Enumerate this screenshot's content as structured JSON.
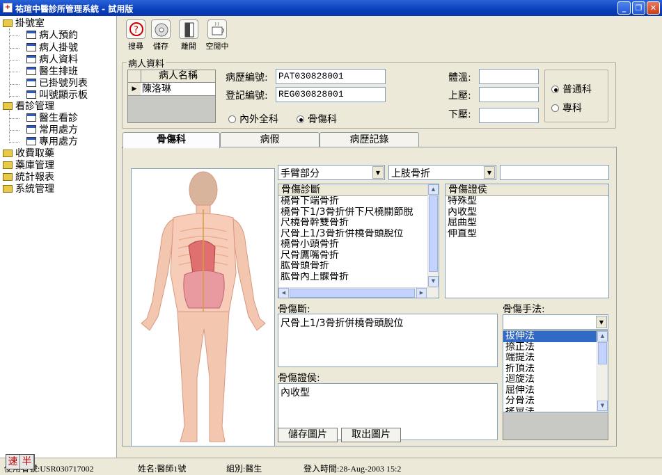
{
  "window": {
    "title": "祐瑄中醫診所管理系統 - 試用版",
    "app_icon_glyph": "+",
    "min": "_",
    "restore": "❐",
    "close": "✕"
  },
  "tree": {
    "groups": [
      {
        "label": "掛號室",
        "children": [
          "病人預約",
          "病人掛號",
          "病人資料",
          "醫生排班",
          "已掛號列表",
          "叫號顯示板"
        ]
      },
      {
        "label": "看診管理",
        "children": [
          "醫生看診",
          "常用處方",
          "專用處方"
        ]
      },
      {
        "label": "收費取藥",
        "children": []
      },
      {
        "label": "藥庫管理",
        "children": []
      },
      {
        "label": "統計報表",
        "children": []
      },
      {
        "label": "系統管理",
        "children": []
      }
    ]
  },
  "toolbar": {
    "search": "搜尋",
    "save": "儲存",
    "leave": "離開",
    "idle": "空閒中"
  },
  "patient": {
    "group_label": "病人資料",
    "grid_header": "病人名稱",
    "grid_row_marker": "▶",
    "grid_row": "陳洛琳",
    "record_no_label": "病歷編號:",
    "record_no": "PAT030828001",
    "reg_no_label": "登記編號:",
    "reg_no": "REG030828001",
    "dept_options": [
      "內外全科",
      "骨傷科"
    ],
    "dept_selected": "骨傷科",
    "temp_label": "體溫:",
    "upper_bp_label": "上壓:",
    "lower_bp_label": "下壓:",
    "temp": "",
    "upper_bp": "",
    "lower_bp": "",
    "clinic_options": [
      "普通科",
      "專科"
    ],
    "clinic_selected": "普通科"
  },
  "tabs": [
    "骨傷科",
    "病假",
    "病歷記錄"
  ],
  "active_tab": "骨傷科",
  "ortho": {
    "body_part": "手臂部分",
    "category": "上肢骨折",
    "extra_input": "",
    "diag_list_header": "骨傷診斷",
    "diag_list": [
      "橈骨下端骨折",
      "橈骨下1/3骨折併下尺橈關節脫",
      "尺橈骨幹雙骨折",
      "尺骨上1/3骨折併橈骨頭脫位",
      "橈骨小頭骨折",
      "尺骨鷹嘴骨折",
      "肱骨頭骨折",
      "肱骨內上髁骨折"
    ],
    "sign_list_header": "骨傷證侯",
    "sign_list": [
      "特殊型",
      "內收型",
      "屈曲型",
      "伸直型"
    ],
    "diag_label": "骨傷斷:",
    "diag_value": "尺骨上1/3骨折併橈骨頭脫位",
    "sign_label": "骨傷證侯:",
    "sign_value": "內收型",
    "method_label": "骨傷手法:",
    "method_select": "",
    "method_list": [
      "拔伸法",
      "捺正法",
      "端提法",
      "折頂法",
      "迴旋法",
      "屈伸法",
      "分骨法",
      "搖晃法"
    ],
    "method_selected": "拔伸法",
    "save_image": "儲存圖片",
    "load_image": "取出圖片"
  },
  "status": {
    "user": "使用者號:USR030717002",
    "name": "姓名:醫師1號",
    "group": "組別:醫生",
    "login": "登入時間:28-Aug-2003 15:2",
    "ime": [
      "速",
      "半"
    ]
  },
  "colors": {
    "titlebar": "#0a3fbd",
    "selection": "#316ac5",
    "window_bg": "#ece9d8"
  }
}
